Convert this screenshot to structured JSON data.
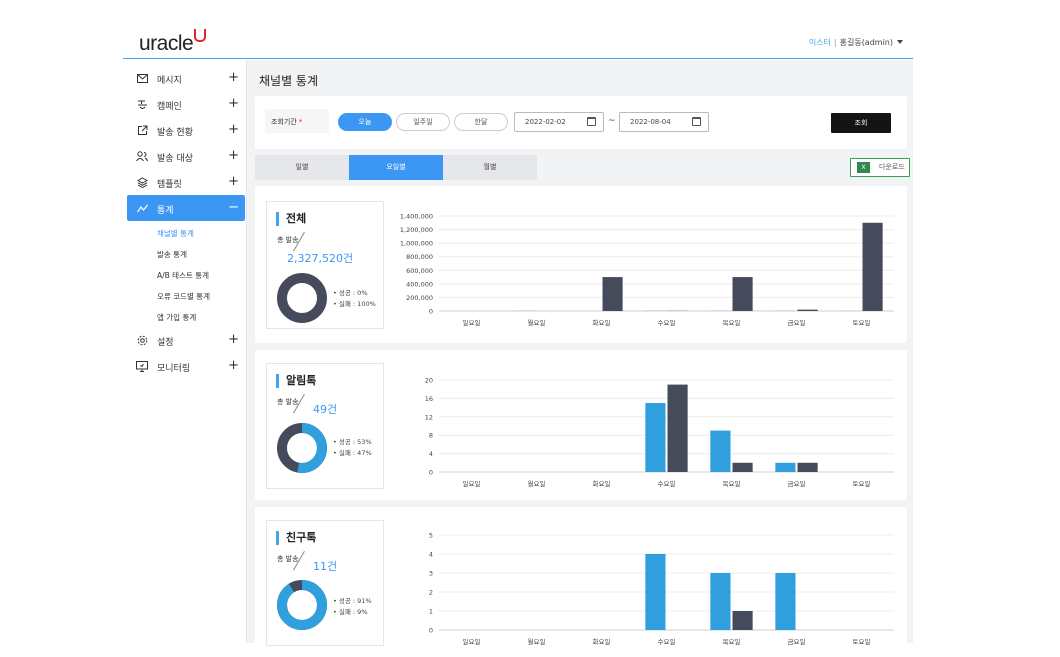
{
  "header": {
    "logo_text": "uracle",
    "site_link": "이스터",
    "separator": "|",
    "user": "홍길동(admin)"
  },
  "sidebar": {
    "items": [
      {
        "label": "메시지",
        "icon": "mail-icon",
        "toggle": "+"
      },
      {
        "label": "캠페인",
        "icon": "campaign-icon",
        "toggle": "+"
      },
      {
        "label": "발송 현황",
        "icon": "external-link-icon",
        "toggle": "+"
      },
      {
        "label": "발송 대상",
        "icon": "users-icon",
        "toggle": "+"
      },
      {
        "label": "템플릿",
        "icon": "layers-icon",
        "toggle": "+"
      },
      {
        "label": "통계",
        "icon": "trend-icon",
        "toggle": "−",
        "active": true
      },
      {
        "label": "설정",
        "icon": "gear-icon",
        "toggle": "+"
      },
      {
        "label": "모니터링",
        "icon": "monitor-icon",
        "toggle": "+"
      }
    ],
    "stats_sub": [
      "채널별 통계",
      "발송 통계",
      "A/B 테스트 통계",
      "오류 코드별 통계",
      "앱 가입 통계"
    ]
  },
  "page_title": "채널별 통계",
  "filter": {
    "label": "조회기간",
    "required_mark": "*",
    "periods": [
      "오늘",
      "일주일",
      "한달"
    ],
    "selected_period": "오늘",
    "start_date": "2022-02-02",
    "tilde": "~",
    "end_date": "2022-08-04",
    "search_label": "조회"
  },
  "tabs": [
    {
      "label": "일별",
      "active": false
    },
    {
      "label": "요일별",
      "active": true
    },
    {
      "label": "월별",
      "active": false
    }
  ],
  "download": {
    "label": "다운로드",
    "icon_text": "X"
  },
  "colors": {
    "primary": "#3b97f3",
    "bar_blue": "#2f9fdd",
    "bar_dark": "#464b5c",
    "accent_red": "#e0262d"
  },
  "sections": [
    {
      "title": "전체",
      "total_label": "총 발송",
      "total_value": "2,327,520건",
      "success_label": "• 성공 : 0%",
      "fail_label": "• 실패 : 100%",
      "success_pct": 0
    },
    {
      "title": "알림톡",
      "total_label": "총 발송",
      "total_value": "49건",
      "success_label": "• 성공 : 53%",
      "fail_label": "• 실패 : 47%",
      "success_pct": 53
    },
    {
      "title": "친구톡",
      "total_label": "총 발송",
      "total_value": "11건",
      "success_label": "• 성공 : 91%",
      "fail_label": "• 실패 : 9%",
      "success_pct": 91
    }
  ],
  "chart_data": [
    {
      "type": "bar",
      "categories": [
        "일요일",
        "월요일",
        "화요일",
        "수요일",
        "목요일",
        "금요일",
        "토요일"
      ],
      "yticks": [
        "1,400,000",
        "1,200,000",
        "1,000,000",
        "800,000",
        "600,000",
        "400,000",
        "200,000",
        "0"
      ],
      "ylim": [
        0,
        1400000
      ],
      "series": [
        {
          "values": [
            0,
            2000,
            0,
            3000,
            2000,
            2000,
            1000
          ]
        },
        {
          "values": [
            0,
            0,
            500000,
            3000,
            500000,
            20000,
            1300000
          ]
        }
      ]
    },
    {
      "type": "bar",
      "categories": [
        "일요일",
        "월요일",
        "화요일",
        "수요일",
        "목요일",
        "금요일",
        "토요일"
      ],
      "yticks": [
        "20",
        "16",
        "12",
        "8",
        "4",
        "0"
      ],
      "ylim": [
        0,
        20
      ],
      "series": [
        {
          "values": [
            0,
            0,
            0,
            15,
            9,
            2,
            0
          ]
        },
        {
          "values": [
            0,
            0,
            0,
            19,
            2,
            2,
            0
          ]
        }
      ]
    },
    {
      "type": "bar",
      "categories": [
        "일요일",
        "월요일",
        "화요일",
        "수요일",
        "목요일",
        "금요일",
        "토요일"
      ],
      "yticks": [
        "5",
        "4",
        "3",
        "2",
        "1",
        "0"
      ],
      "ylim": [
        0,
        5
      ],
      "series": [
        {
          "values": [
            0,
            0,
            0,
            4,
            3,
            3,
            0
          ]
        },
        {
          "values": [
            0,
            0,
            0,
            0,
            1,
            0,
            0
          ]
        }
      ]
    }
  ]
}
